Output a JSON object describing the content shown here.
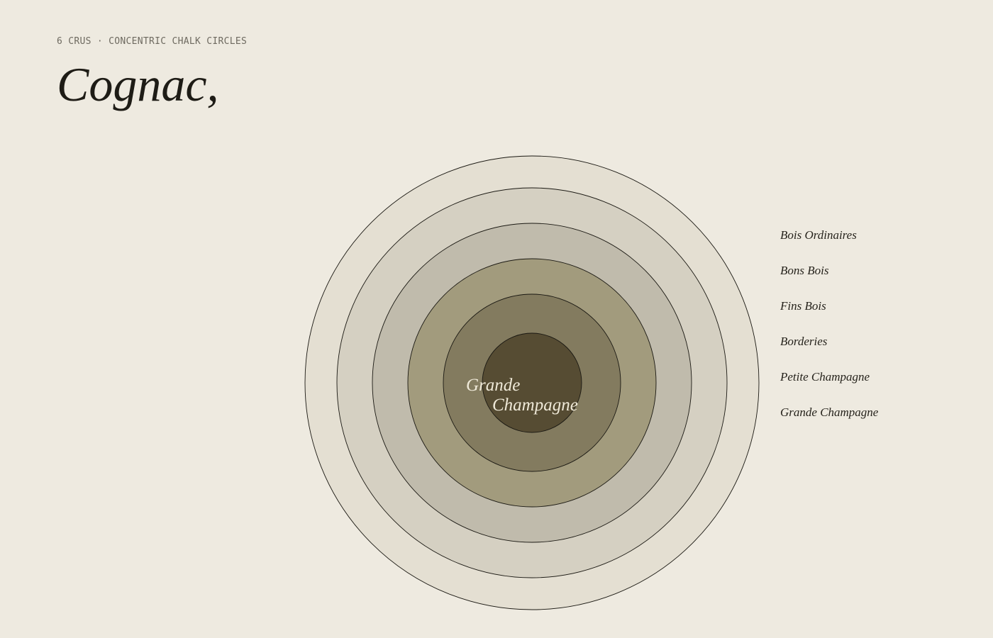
{
  "header": {
    "eyebrow": "6 CRUS · CONCENTRIC CHALK CIRCLES",
    "title": "Cognac,"
  },
  "diagram": {
    "center_label_line1": "Grande",
    "center_label_line2": "Champagne",
    "crus": [
      {
        "name": "Bois Ordinaires",
        "color": "#e4dfd2"
      },
      {
        "name": "Bons Bois",
        "color": "#d5d0c2"
      },
      {
        "name": "Fins Bois",
        "color": "#c0bbac"
      },
      {
        "name": "Borderies",
        "color": "#a29b7d"
      },
      {
        "name": "Petite Champagne",
        "color": "#837b5f"
      },
      {
        "name": "Grande Champagne",
        "color": "#564c33"
      }
    ]
  }
}
